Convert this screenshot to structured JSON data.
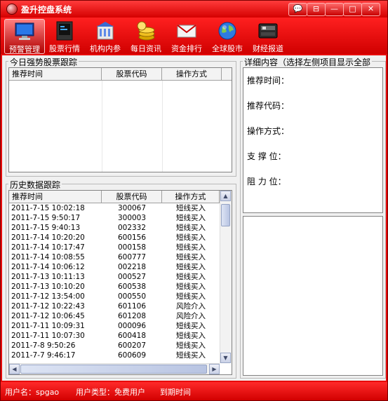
{
  "window": {
    "title": "盈升控盘系统",
    "controls": [
      "💬",
      "⊟",
      "—",
      "□",
      "✕"
    ]
  },
  "toolbar": {
    "items": [
      {
        "label": "预警管理",
        "icon": "monitor-icon"
      },
      {
        "label": "股票行情",
        "icon": "screen-icon"
      },
      {
        "label": "机构内参",
        "icon": "building-icon"
      },
      {
        "label": "每日资讯",
        "icon": "coins-icon"
      },
      {
        "label": "资金排行",
        "icon": "envelope-icon"
      },
      {
        "label": "全球股市",
        "icon": "globe-icon"
      },
      {
        "label": "财经报道",
        "icon": "radio-icon"
      }
    ]
  },
  "today_panel": {
    "title": "今日强势股票跟踪",
    "columns": [
      "推荐时间",
      "股票代码",
      "操作方式"
    ],
    "rows": []
  },
  "history_panel": {
    "title": "历史数据跟踪",
    "columns": [
      "推荐时间",
      "股票代码",
      "操作方式"
    ],
    "rows": [
      [
        "2011-7-15 10:02:18",
        "300067",
        "短线买入"
      ],
      [
        "2011-7-15 9:50:17",
        "300003",
        "短线买入"
      ],
      [
        "2011-7-15 9:40:13",
        "002332",
        "短线买入"
      ],
      [
        "2011-7-14 10:20:20",
        "600156",
        "短线买入"
      ],
      [
        "2011-7-14 10:17:47",
        "000158",
        "短线买入"
      ],
      [
        "2011-7-14 10:08:55",
        "600777",
        "短线买入"
      ],
      [
        "2011-7-14 10:06:12",
        "002218",
        "短线买入"
      ],
      [
        "2011-7-13 10:11:13",
        "000527",
        "短线买入"
      ],
      [
        "2011-7-13 10:10:20",
        "600538",
        "短线买入"
      ],
      [
        "2011-7-12 13:54:00",
        "000550",
        "短线买入"
      ],
      [
        "2011-7-12 10:22:43",
        "601106",
        "风险介入"
      ],
      [
        "2011-7-12 10:06:45",
        "601208",
        "风险介入"
      ],
      [
        "2011-7-11 10:09:31",
        "000096",
        "短线买入"
      ],
      [
        "2011-7-11 10:07:30",
        "600418",
        "短线买入"
      ],
      [
        "2011-7-8 9:50:26",
        "600207",
        "短线买入"
      ],
      [
        "2011-7-7 9:46:17",
        "600609",
        "短线买入"
      ]
    ]
  },
  "detail_panel": {
    "title": "详细内容（选择左侧项目显示全部",
    "fields": [
      {
        "label": "推荐时间："
      },
      {
        "label": "推荐代码："
      },
      {
        "label": "操作方式："
      },
      {
        "label": "支 撑 位："
      },
      {
        "label": "阻 力 位："
      }
    ]
  },
  "status": {
    "username": "用户名：spgao",
    "user_type": "用户类型：免费用户",
    "expiry": "到期时间"
  }
}
